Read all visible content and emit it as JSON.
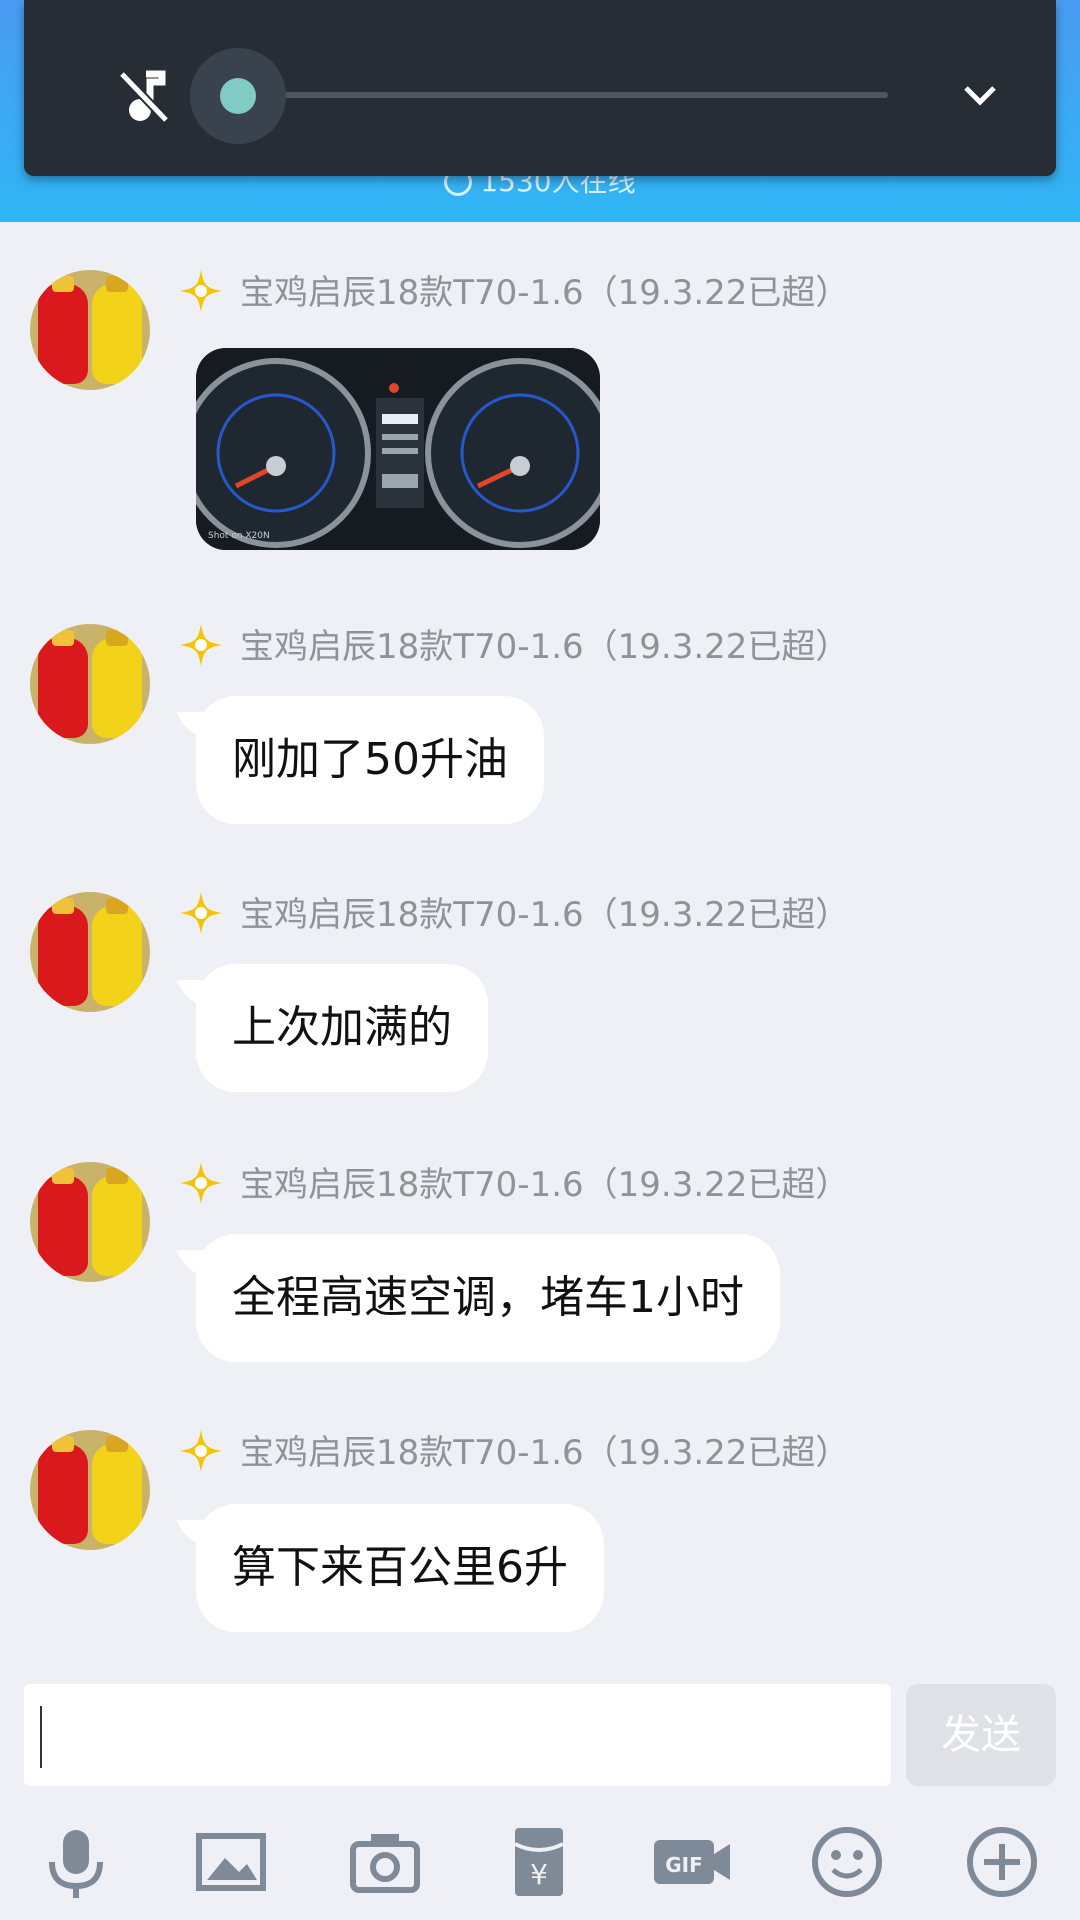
{
  "header": {
    "online_text": "1530人在线"
  },
  "music": {
    "progress": 0.0
  },
  "messages": [
    {
      "nickname": "宝鸡启辰18款T70-1.6（19.3.22已超）",
      "type": "image",
      "image_caption": "Shot on X20N"
    },
    {
      "nickname": "宝鸡启辰18款T70-1.6（19.3.22已超）",
      "type": "text",
      "text": "刚加了50升油"
    },
    {
      "nickname": "宝鸡启辰18款T70-1.6（19.3.22已超）",
      "type": "text",
      "text": "上次加满的"
    },
    {
      "nickname": "宝鸡启辰18款T70-1.6（19.3.22已超）",
      "type": "text",
      "text": "全程高速空调，堵车1小时"
    },
    {
      "nickname": "宝鸡启辰18款T70-1.6（19.3.22已超）",
      "type": "text",
      "text": "算下来百公里6升"
    }
  ],
  "input": {
    "value": "",
    "send_label": "发送"
  },
  "toolbar": {
    "icons": [
      "microphone-icon",
      "image-icon",
      "camera-icon",
      "red-packet-icon",
      "gif-icon",
      "emoji-icon",
      "plus-icon"
    ]
  },
  "colors": {
    "header": "#3aa8f4",
    "popup": "#262d35",
    "accent": "#80cbc4",
    "background": "#eff0f5",
    "star": "#f5c400"
  }
}
